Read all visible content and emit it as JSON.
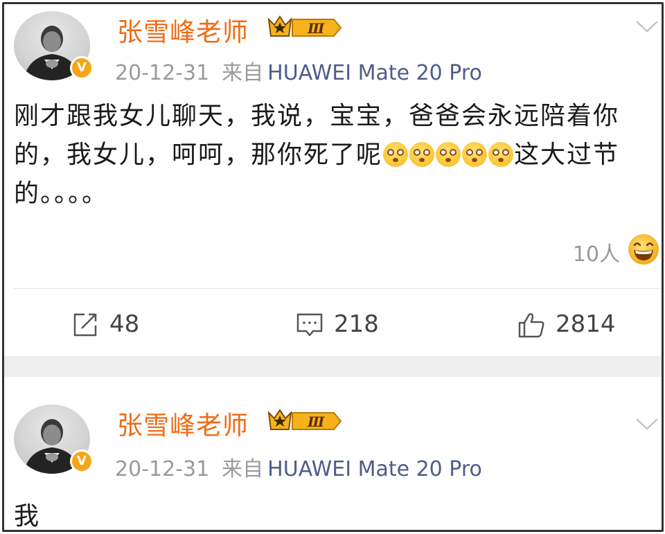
{
  "posts": [
    {
      "username": "张雪峰老师",
      "vip_level": "Ⅲ",
      "verified_mark": "V",
      "date": "20-12-31",
      "source_prefix": "来自",
      "device": "HUAWEI Mate 20 Pro",
      "content_part1": "刚才跟我女儿聊天，我说，宝宝，爸爸会永远陪着你的，我女儿，呵呵，那你死了呢",
      "emoji_name": "dizzy-face-emoji",
      "emoji_count": 5,
      "content_part2": "这大过节的。。。。",
      "reaction_count": "10人",
      "reaction_icon": "laughing-face-icon",
      "repost_count": "48",
      "comment_count": "218",
      "like_count": "2814"
    },
    {
      "username": "张雪峰老师",
      "vip_level": "Ⅲ",
      "verified_mark": "V",
      "date": "20-12-31",
      "source_prefix": "来自",
      "device": "HUAWEI Mate 20 Pro",
      "content": "我"
    }
  ],
  "colors": {
    "username": "#f26b13",
    "device": "#4e5c8a",
    "meta": "#9a9a9a",
    "verified_badge": "#f6a614",
    "separator": "#eeeeee"
  }
}
